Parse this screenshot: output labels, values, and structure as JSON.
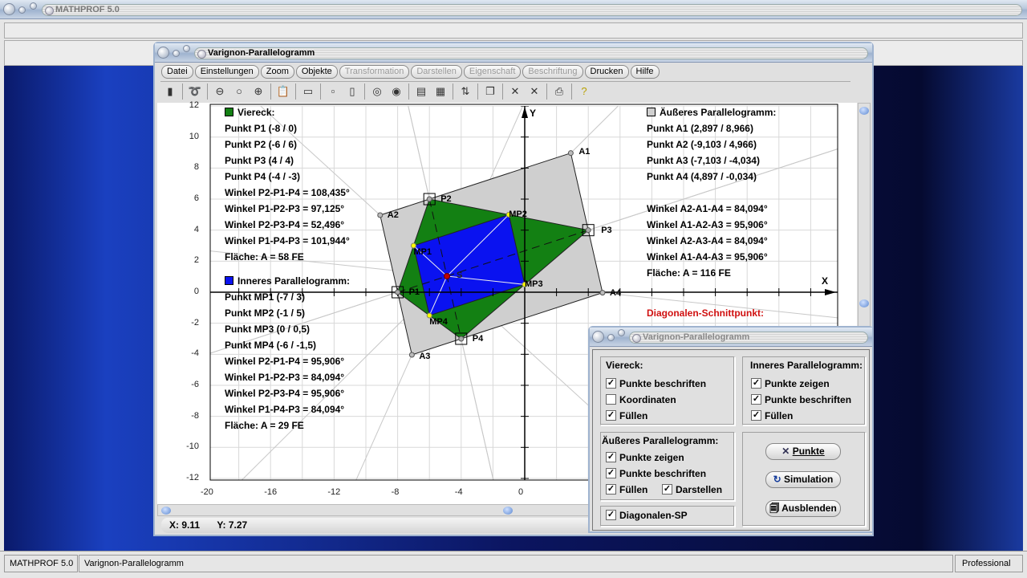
{
  "app": {
    "title": "MATHPROF 5.0"
  },
  "window": {
    "title": "Varignon-Parallelogramm",
    "menu": [
      {
        "label": "Datei",
        "enabled": true
      },
      {
        "label": "Einstellungen",
        "enabled": true
      },
      {
        "label": "Zoom",
        "enabled": true
      },
      {
        "label": "Objekte",
        "enabled": true
      },
      {
        "label": "Transformation",
        "enabled": false
      },
      {
        "label": "Darstellen",
        "enabled": false
      },
      {
        "label": "Eigenschaft",
        "enabled": false
      },
      {
        "label": "Beschriftung",
        "enabled": false
      },
      {
        "label": "Drucken",
        "enabled": true
      },
      {
        "label": "Hilfe",
        "enabled": true
      }
    ],
    "toolbar_icons": [
      "exit-icon",
      "glasses-icon",
      "zoom-out-icon",
      "zoom-icon",
      "zoom-in-icon",
      "clipboard-icon",
      "window-icon",
      "single-frame-icon",
      "double-frame-icon",
      "circle-icon",
      "circle2-icon",
      "table-icon",
      "chart-icon",
      "export-icon",
      "pages-icon",
      "cross-icon",
      "cross2-icon",
      "print-icon",
      "help-icon"
    ]
  },
  "plot": {
    "axis_x_label": "X",
    "axis_y_label": "Y",
    "xlim": [
      -20,
      19.7
    ],
    "ylim": [
      -12,
      12
    ],
    "x_ticks": [
      "-20",
      "-16",
      "-12",
      "-8",
      "-4",
      "0"
    ],
    "y_ticks": [
      "12",
      "10",
      "8",
      "6",
      "4",
      "2",
      "0",
      "-2",
      "-4",
      "-6",
      "-8",
      "-10",
      "-12"
    ],
    "quad": {
      "P1": [
        -8,
        0
      ],
      "P2": [
        -6,
        6
      ],
      "P3": [
        4,
        4
      ],
      "P4": [
        -4,
        -3
      ]
    },
    "outer": {
      "A1": [
        2.897,
        8.966
      ],
      "A2": [
        -9.103,
        4.966
      ],
      "A3": [
        -7.103,
        -4.034
      ],
      "A4": [
        4.897,
        -0.034
      ]
    },
    "inner": {
      "MP1": [
        -7,
        3
      ],
      "MP2": [
        -1,
        5
      ],
      "MP3": [
        0,
        0.5
      ],
      "MP4": [
        -6,
        -1.5
      ]
    },
    "S": [
      -4.897,
      1.034
    ],
    "S_label": "S",
    "colors": {
      "quad": "#138013",
      "inner": "#0a12f0",
      "outer": "#cfcfcf",
      "s": "#c00000"
    }
  },
  "left_info": {
    "viereck_title": "Viereck:",
    "viereck": [
      "Punkt P1 (-8 / 0)",
      "Punkt P2 (-6 / 6)",
      "Punkt P3 (4 / 4)",
      "Punkt P4 (-4 / -3)",
      "Winkel P2-P1-P4 = 108,435°",
      "Winkel P1-P2-P3 = 97,125°",
      "Winkel P2-P3-P4 = 52,496°",
      "Winkel P1-P4-P3 = 101,944°",
      "Fläche: A = 58 FE"
    ],
    "inner_title": "Inneres Parallelogramm:",
    "inner": [
      "Punkt MP1 (-7 / 3)",
      "Punkt MP2 (-1 / 5)",
      "Punkt MP3 (0 / 0,5)",
      "Punkt MP4 (-6 / -1,5)",
      "Winkel P2-P1-P4 = 95,906°",
      "Winkel P1-P2-P3 = 84,094°",
      "Winkel P2-P3-P4 = 95,906°",
      "Winkel P1-P4-P3 = 84,094°",
      "Fläche: A = 29 FE"
    ]
  },
  "right_info": {
    "title": "Äußeres Parallelogramm:",
    "items": [
      "Punkt A1 (2,897 / 8,966)",
      "Punkt A2 (-9,103 / 4,966)",
      "Punkt A3 (-7,103 / -4,034)",
      "Punkt A4 (4,897 / -0,034)",
      "",
      "Winkel A2-A1-A4 = 84,094°",
      "Winkel A1-A2-A3 = 95,906°",
      "Winkel A2-A3-A4 = 84,094°",
      "Winkel A1-A4-A3 = 95,906°",
      "Fläche: A = 116 FE"
    ],
    "diag_title": "Diagonalen-Schnittpunkt:"
  },
  "coords": {
    "x": "X: 9.11",
    "y": "Y: 7.27"
  },
  "dialog": {
    "title": "Varignon-Parallelogramm",
    "viereck": {
      "title": "Viereck:",
      "items": [
        {
          "label": "Punkte beschriften",
          "checked": true
        },
        {
          "label": "Koordinaten",
          "checked": false
        },
        {
          "label": "Füllen",
          "checked": true
        }
      ]
    },
    "inner": {
      "title": "Inneres Parallelogramm:",
      "items": [
        {
          "label": "Punkte zeigen",
          "checked": true
        },
        {
          "label": "Punkte beschriften",
          "checked": true
        },
        {
          "label": "Füllen",
          "checked": true
        }
      ]
    },
    "outer": {
      "title": "Äußeres Parallelogramm:",
      "items": [
        {
          "label": "Punkte zeigen",
          "checked": true
        },
        {
          "label": "Punkte beschriften",
          "checked": true
        },
        {
          "label": "Füllen",
          "checked": true
        },
        {
          "label": "Darstellen",
          "checked": true
        }
      ]
    },
    "diag": {
      "label": "Diagonalen-SP",
      "checked": true
    },
    "buttons": {
      "punkte": "Punkte",
      "simulation": "Simulation",
      "ausblenden": "Ausblenden"
    }
  },
  "statusbar": {
    "app": "MATHPROF 5.0",
    "module": "Varignon-Parallelogramm",
    "edition": "Professional"
  }
}
